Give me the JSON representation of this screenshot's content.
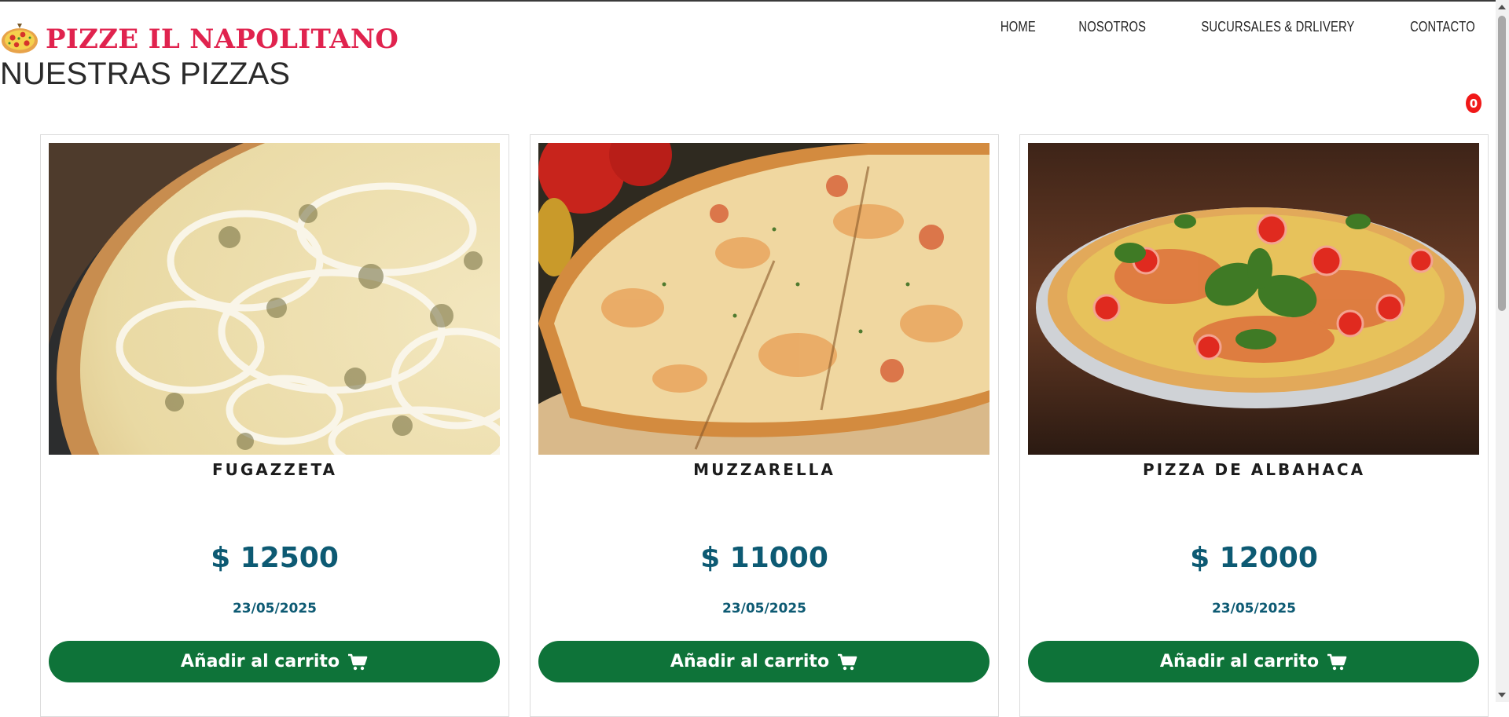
{
  "header": {
    "brand_name": "PIZZE IL NAPOLITANO",
    "brand_color": "#e0234e",
    "section_title": "NUESTRAS PIZZAS",
    "nav": [
      "HOME",
      "NOSOTROS",
      "SUCURSALES & DRLIVERY",
      "CONTACTO"
    ],
    "cart_count": "0"
  },
  "products": [
    {
      "name": "FUGAZZETA",
      "price": "$ 12500",
      "date": "23/05/2025",
      "button_label": "Añadir al carrito"
    },
    {
      "name": "MUZZARELLA",
      "price": "$ 11000",
      "date": "23/05/2025",
      "button_label": "Añadir al carrito"
    },
    {
      "name": "PIZZA DE ALBAHACA",
      "price": "$ 12000",
      "date": "23/05/2025",
      "button_label": "Añadir al carrito"
    }
  ],
  "colors": {
    "price": "#0d5a73",
    "button": "#0e7339",
    "badge": "#f01818"
  },
  "icons": {
    "brand": "pizza-icon",
    "button": "shopping-cart-icon"
  }
}
